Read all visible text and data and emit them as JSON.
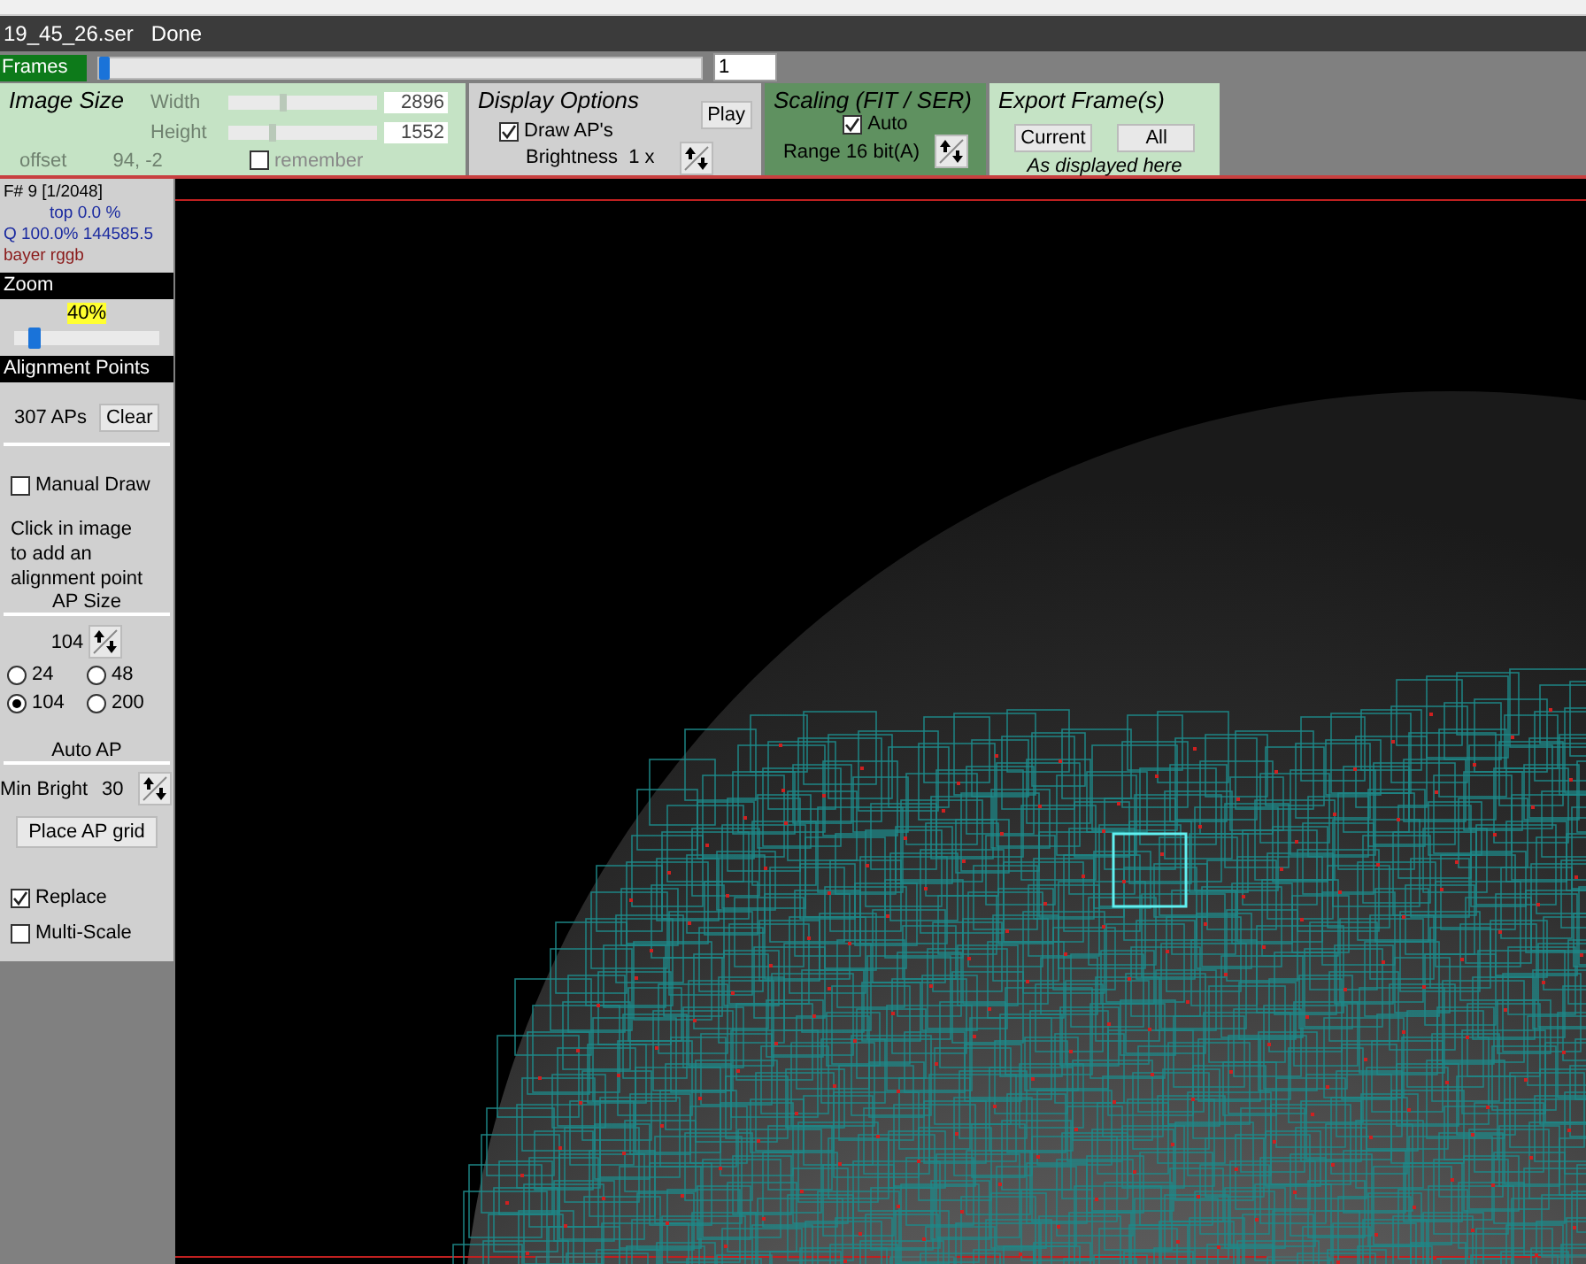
{
  "title_bar": {
    "file": "19_45_26.ser",
    "status": "Done"
  },
  "frames": {
    "label": "Frames",
    "level": 0,
    "value": "1"
  },
  "image_size": {
    "title": "Image Size",
    "width": {
      "label": "Width",
      "level": 0.34,
      "value": "2896",
      "disabled": true
    },
    "height": {
      "label": "Height",
      "level": 0.27,
      "value": "1552",
      "disabled": true
    },
    "offset": {
      "label": "offset",
      "value": "94, -2",
      "disabled": true
    },
    "remember": {
      "label": "remember",
      "checked": false
    }
  },
  "display_options": {
    "title": "Display Options",
    "draw_aps": {
      "label": "Draw AP's",
      "checked": true
    },
    "brightness": "Brightness  1 x",
    "play": "Play"
  },
  "scaling": {
    "title": "Scaling (FIT / SER)",
    "auto": {
      "label": "Auto",
      "checked": true
    },
    "range": "Range 16 bit(A)"
  },
  "export": {
    "title": "Export Frame(s)",
    "buttons": [
      "Current",
      "All"
    ],
    "note": "As displayed here"
  },
  "info": {
    "frame": "F# 9 [1/2048]",
    "top": "top 0.0 %",
    "quality": "Q 100.0%  144585.5",
    "bayer": "bayer rggb"
  },
  "zoom": {
    "header": "Zoom",
    "value": "40%",
    "level": 0.1
  },
  "alignment": {
    "header": "Alignment Points",
    "count": "307 APs",
    "clear": "Clear",
    "manual_draw": {
      "label": "Manual Draw",
      "checked": false
    },
    "hint": "Click in image to add an alignment point",
    "ap_size_label": "AP Size",
    "ap_size_value": "104",
    "sizes": [
      {
        "label": "24",
        "selected": false
      },
      {
        "label": "48",
        "selected": false
      },
      {
        "label": "104",
        "selected": true
      },
      {
        "label": "200",
        "selected": false
      }
    ],
    "auto_ap_label": "Auto AP",
    "min_bright_label": "Min Bright",
    "min_bright_value": "30",
    "place_grid": "Place AP grid",
    "replace": {
      "label": "Replace",
      "checked": true
    },
    "multi_scale": {
      "label": "Multi-Scale",
      "checked": false
    }
  }
}
